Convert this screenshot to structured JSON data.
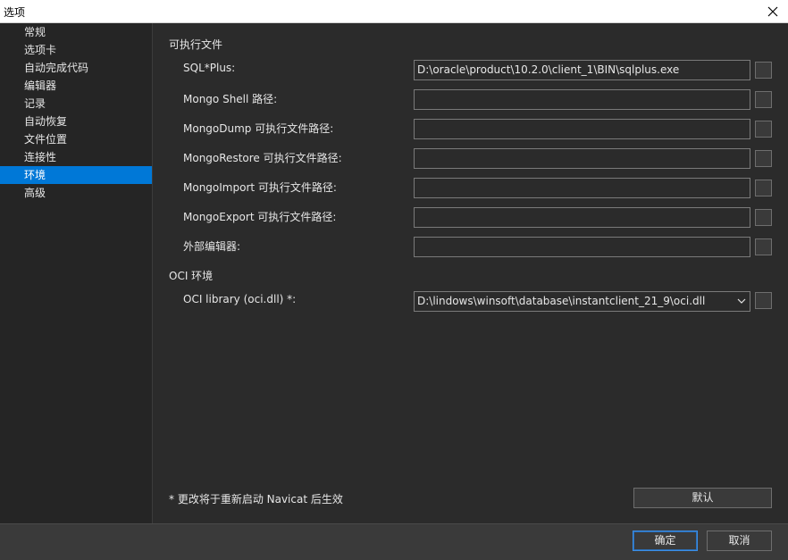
{
  "window": {
    "title": "选项"
  },
  "sidebar": {
    "items": [
      {
        "label": "常规"
      },
      {
        "label": "选项卡"
      },
      {
        "label": "自动完成代码"
      },
      {
        "label": "编辑器"
      },
      {
        "label": "记录"
      },
      {
        "label": "自动恢复"
      },
      {
        "label": "文件位置"
      },
      {
        "label": "连接性"
      },
      {
        "label": "环境"
      },
      {
        "label": "高级"
      }
    ],
    "selected": "环境"
  },
  "main": {
    "sections": {
      "executables": "可执行文件",
      "oci": "OCI 环境"
    },
    "fields": [
      {
        "label": "SQL*Plus:",
        "value": "D:\\oracle\\product\\10.2.0\\client_1\\BIN\\sqlplus.exe"
      },
      {
        "label": "Mongo Shell 路径:",
        "value": ""
      },
      {
        "label": "MongoDump 可执行文件路径:",
        "value": ""
      },
      {
        "label": "MongoRestore 可执行文件路径:",
        "value": ""
      },
      {
        "label": "MongoImport 可执行文件路径:",
        "value": ""
      },
      {
        "label": "MongoExport 可执行文件路径:",
        "value": ""
      },
      {
        "label": "外部编辑器:",
        "value": ""
      }
    ],
    "oci_library": {
      "label": "OCI library (oci.dll) *:",
      "value": "D:\\lindows\\winsoft\\database\\instantclient_21_9\\oci.dll"
    },
    "note": "* 更改将于重新启动 Navicat 后生效",
    "default_button": "默认"
  },
  "footer": {
    "ok": "确定",
    "cancel": "取消"
  }
}
